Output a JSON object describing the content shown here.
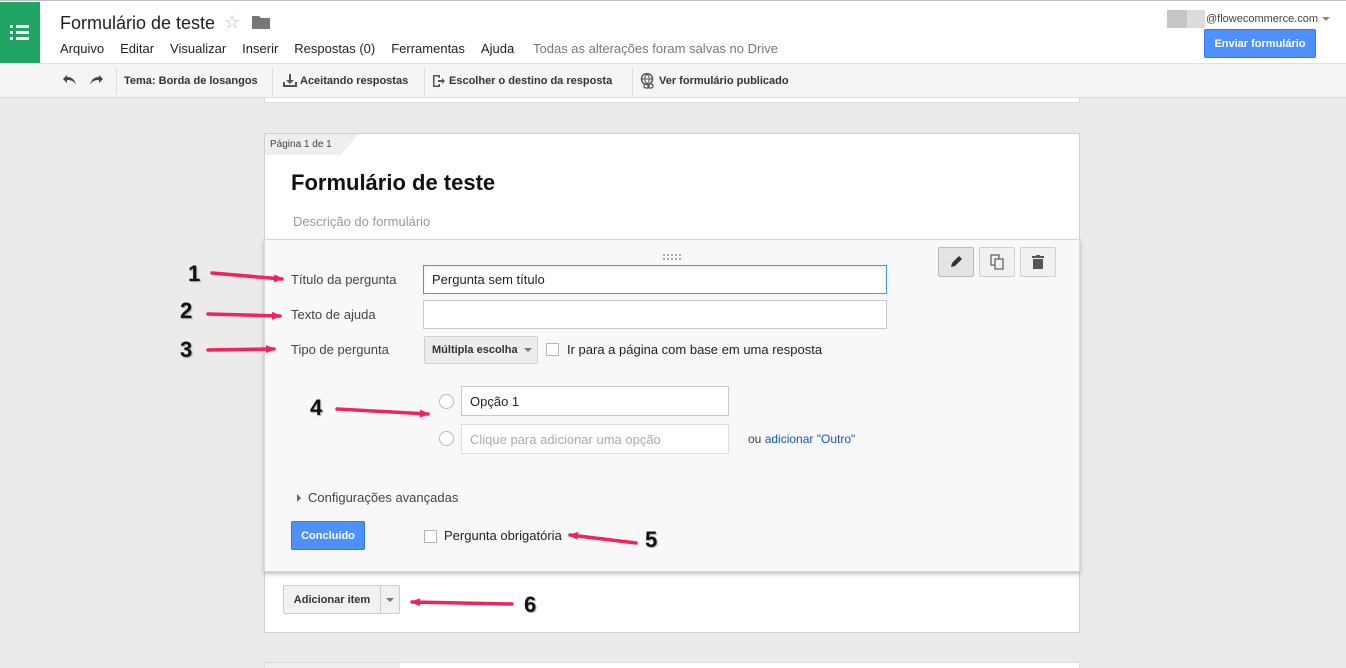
{
  "app": {
    "title": "Formulário de teste",
    "save_status": "Todas as alterações foram salvas no Drive",
    "account_email": "@flowecommerce.com",
    "send_button": "Enviar formulário",
    "accent_color": "#4d90fe",
    "logo_color": "#1fa463"
  },
  "menu": [
    "Arquivo",
    "Editar",
    "Visualizar",
    "Inserir",
    "Respostas (0)",
    "Ferramentas",
    "Ajuda"
  ],
  "toolbar": {
    "theme": "Tema: Borda de losangos",
    "accepting": "Aceitando respostas",
    "destination": "Escolher o destino da resposta",
    "view_published": "Ver formulário publicado"
  },
  "form": {
    "page_label": "Página 1 de 1",
    "title": "Formulário de teste",
    "description_placeholder": "Descrição do formulário"
  },
  "question": {
    "title_label": "Título da pergunta",
    "title_value": "Pergunta sem título",
    "help_label": "Texto de ajuda",
    "help_value": "",
    "type_label": "Tipo de pergunta",
    "type_value": "Múltipla escolha",
    "go_to_page_label": "Ir para a página com base em uma resposta",
    "option1_value": "Opção 1",
    "add_option_placeholder": "Clique para adicionar uma opção",
    "or_text": "ou",
    "add_other_link": "adicionar \"Outro\"",
    "advanced_settings": "Configurações avançadas",
    "done_button": "Concluído",
    "required_label": "Pergunta obrigatória"
  },
  "add_item": "Adicionar item",
  "annotations": [
    "1",
    "2",
    "3",
    "4",
    "5",
    "6"
  ],
  "annotation_color": "#f0245a"
}
